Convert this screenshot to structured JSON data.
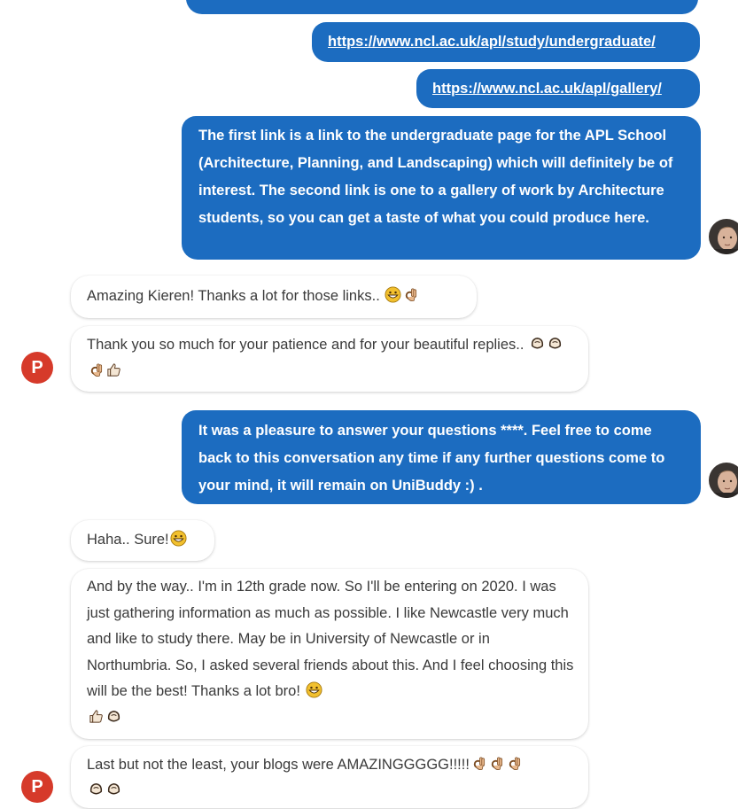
{
  "colors": {
    "outgoing_bubble": "#1c6cc0",
    "incoming_bubble": "#ffffff",
    "avatar_p": "#d63a2a"
  },
  "icons": {
    "grin": "grinning-face-emoji",
    "ok": "ok-hand-emoji",
    "clap": "clapping-hands-emoji",
    "thumb": "thumbs-up-emoji"
  },
  "avatars": {
    "user_initial": "P"
  },
  "messages": {
    "link_1": "https://www.ncl.ac.uk/apl/study/undergraduate/",
    "link_2": "https://www.ncl.ac.uk/apl/gallery/",
    "reply_1": "The first link is a link to the undergraduate page for the APL School (Architecture, Planning, and Landscaping) which will definitely be of interest. The second link is one to a gallery of work by Architecture students, so you can get a taste of what you could produce here.",
    "in_1": "Amazing Kieren! Thanks a lot for those links..",
    "in_2": "Thank you so much for your patience and for your beautiful replies..",
    "reply_2": "It was a pleasure to answer your questions ****. Feel free to come back to this conversation any time if any further questions come to your mind, it will remain on UniBuddy :) .",
    "in_3": "Haha.. Sure!",
    "in_4": "And by the way.. I'm in 12th grade now. So I'll be entering on 2020. I was just gathering information as much as possible. I like Newcastle very much and like to study there. May be in University of Newcastle or in Northumbria. So, I asked several friends about this. And I feel choosing this will be the best! Thanks a lot bro!",
    "in_5": "Last but not the least, your blogs were AMAZINGGGGG!!!!!"
  }
}
